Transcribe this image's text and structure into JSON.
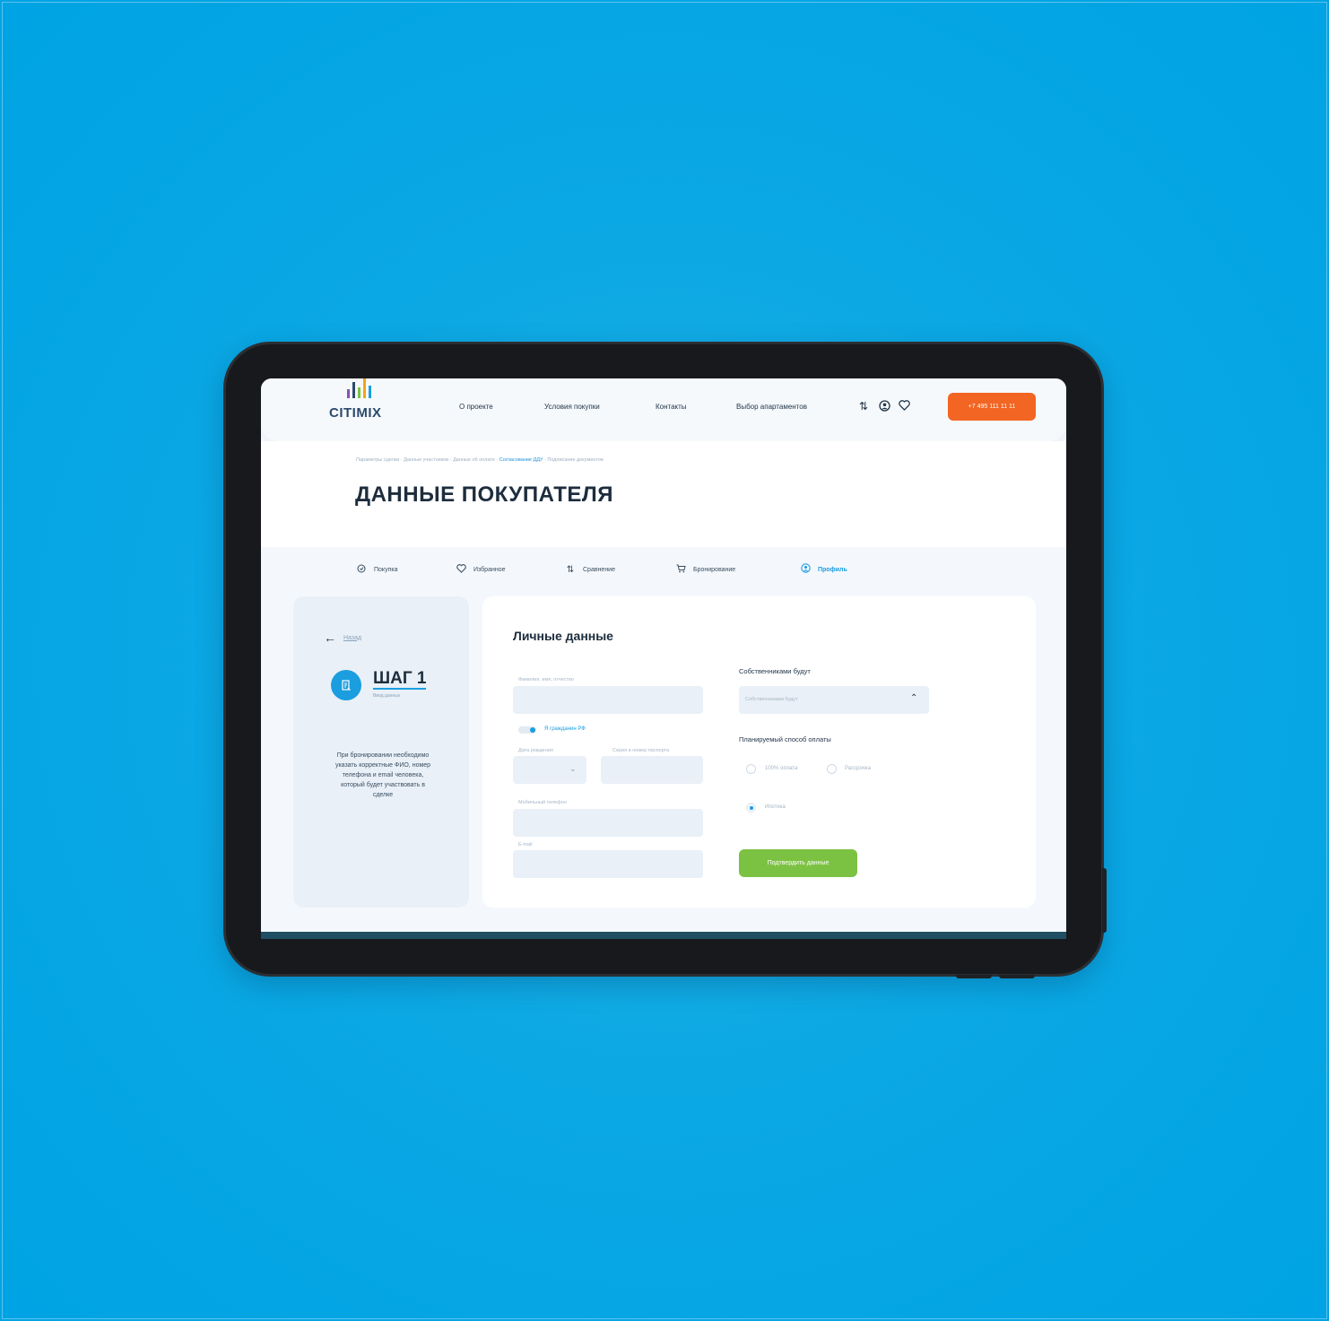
{
  "colors": {
    "background": "#00a3e3",
    "accent_blue": "#1a9ee0",
    "phone_button": "#f26522",
    "confirm_button": "#7cc242",
    "title_text": "#1d2d3d"
  },
  "header": {
    "logo_text": "CITIMIX",
    "nav": [
      "О проекте",
      "Условия покупки",
      "Контакты",
      "Выбор апартаментов"
    ],
    "icons": [
      "compare-icon",
      "profile-icon",
      "heart-icon"
    ],
    "phone": "+7 495 111 11 11"
  },
  "breadcrumb": {
    "items": [
      "Параметры сделки",
      "Данные участников",
      "Данные об оплате",
      "Согласование ДДУ",
      "Подписание документов"
    ],
    "active_index": 3
  },
  "page_title": "ДАННЫЕ ПОКУПАТЕЛЯ",
  "tabs": [
    {
      "label": "Покупка",
      "icon": "purchase-icon"
    },
    {
      "label": "Избранное",
      "icon": "heart-icon"
    },
    {
      "label": "Сравнение",
      "icon": "compare-icon"
    },
    {
      "label": "Бронирование",
      "icon": "cart-icon"
    },
    {
      "label": "Профиль",
      "icon": "profile-icon",
      "active": true
    }
  ],
  "left_panel": {
    "back_label": "Назад",
    "step_title": "ШАГ 1",
    "step_subtitle": "Ввод данных",
    "hint": "При бронировании необходимо указать корректные ФИО, номер телефона и email человека, который будет участвовать в сделке"
  },
  "form": {
    "title": "Личные данные",
    "fio_label": "Фамилия, имя, отчество",
    "citizen_toggle_label": "Я гражданин РФ",
    "birthdate_label": "Дата рождения",
    "passport_label": "Серия и номер паспорта",
    "phone_label": "Мобильный телефон",
    "email_label": "E-mail",
    "owners_label": "Собственниками будут",
    "owners_placeholder": "Собственниками будут",
    "payment_label": "Планируемый способ оплаты",
    "payment_options": [
      {
        "label": "100% оплата",
        "checked": false
      },
      {
        "label": "Рассрочка",
        "checked": false
      },
      {
        "label": "Ипотека",
        "checked": true
      }
    ],
    "submit_label": "Подтвердить данные"
  }
}
